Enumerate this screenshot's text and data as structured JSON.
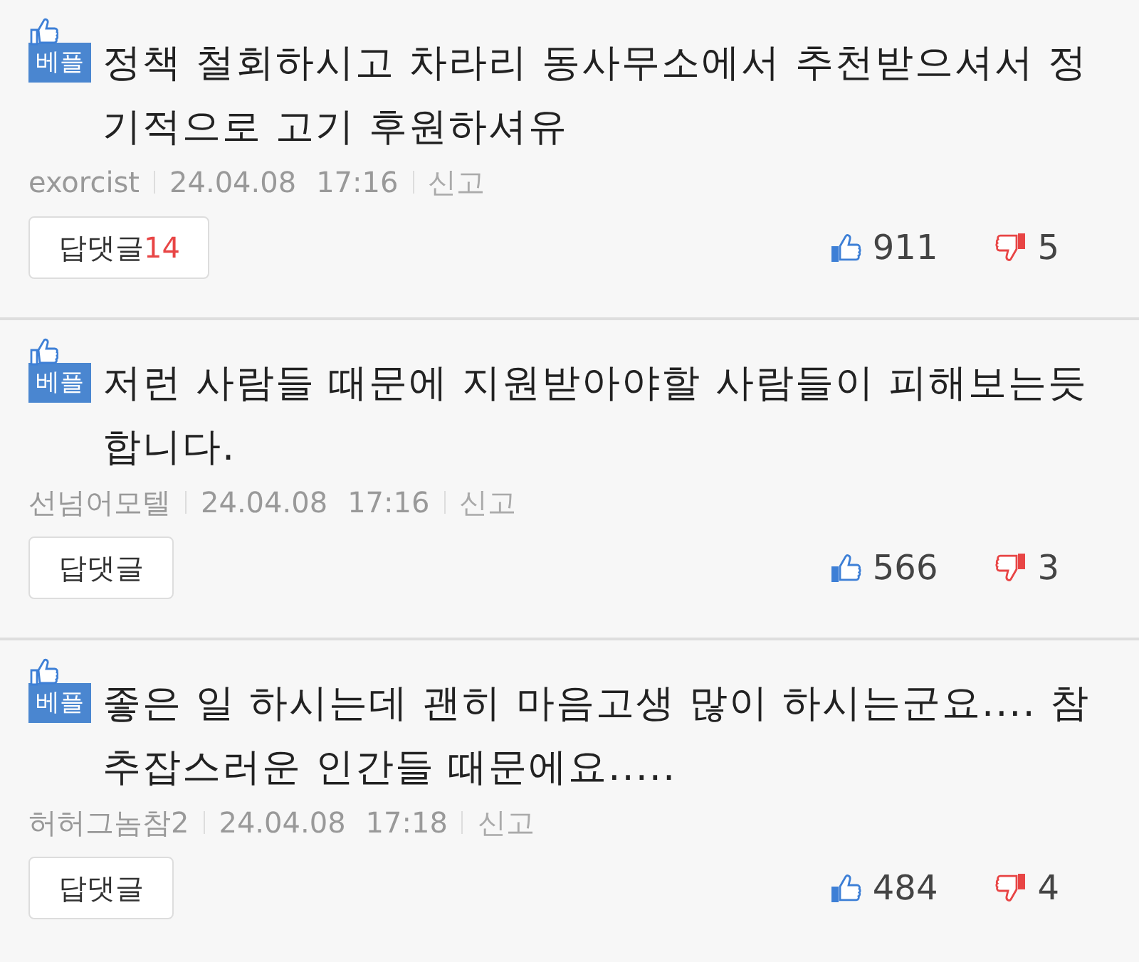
{
  "comments": [
    {
      "badge": "베플",
      "text": "정책 철회하시고 차라리 동사무소에서 추천받으셔서 정기적으로 고기 후원하셔유",
      "author": "exorcist",
      "date": "24.04.08",
      "time": "17:16",
      "report": "신고",
      "reply_label": "답댓글",
      "reply_count": "14",
      "likes": "911",
      "dislikes": "5"
    },
    {
      "badge": "베플",
      "text": "저런 사람들 때문에 지원받아야할 사람들이 피해보는듯 합니다.",
      "author": "선넘어모텔",
      "date": "24.04.08",
      "time": "17:16",
      "report": "신고",
      "reply_label": "답댓글",
      "likes": "566",
      "dislikes": "3"
    },
    {
      "badge": "베플",
      "text": "좋은 일 하시는데 괜히 마음고생 많이 하시는군요.... 참 추잡스러운 인간들 때문에요.....",
      "author": "허허그놈참2",
      "date": "24.04.08",
      "time": "17:18",
      "report": "신고",
      "reply_label": "답댓글",
      "likes": "484",
      "dislikes": "4"
    }
  ]
}
